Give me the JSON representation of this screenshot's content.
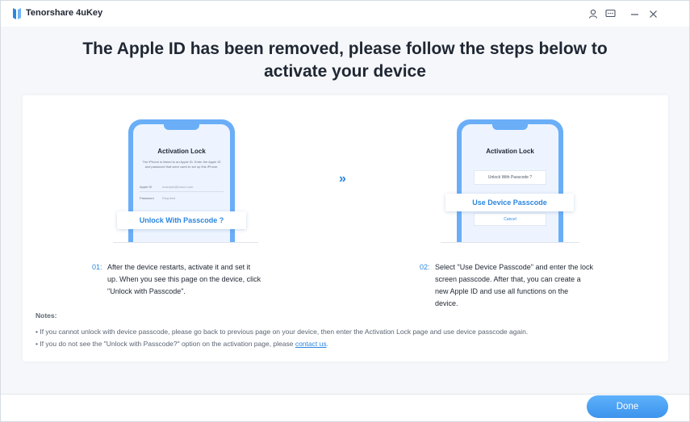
{
  "app": {
    "title": "Tenorshare 4uKey"
  },
  "titlebar": {
    "icons": [
      "user-icon",
      "feedback-icon",
      "minimize-icon",
      "close-icon"
    ]
  },
  "heading": {
    "line1": "The Apple ID has been removed, please follow the steps below to",
    "line2": "activate your device"
  },
  "phone1": {
    "title": "Activation Lock",
    "desc": "The iPhone is linked to an Apple ID. Enter the Apple ID and password that were used to set up this iPhone.",
    "apple_id_label": "Apple ID",
    "apple_id_value": "example@icloud.com",
    "password_label": "Password",
    "password_value": "Required",
    "button": "Unlock With Passcode ?"
  },
  "phone2": {
    "title": "Activation Lock",
    "option1": "Unlock With Passcode ?",
    "button": "Use Device Passcode",
    "cancel": "Cancel"
  },
  "steps": [
    {
      "num": "01:",
      "lines": [
        "After the device restarts, activate it and set it",
        "up. When you see this page on the device, click",
        "\"Unlock with Passcode\"."
      ]
    },
    {
      "num": "02:",
      "lines": [
        "Select \"Use Device Passcode\" and enter the lock",
        "screen passcode. After that, you can create a",
        "new Apple ID and use all functions on the",
        "device."
      ]
    }
  ],
  "notes": {
    "label": "Notes:",
    "item1": "• If you cannot unlock with device passcode, please go back to previous page on your device, then enter the Activation Lock page and use device passcode again.",
    "item2_prefix": "• If you do not see the \"Unlock with Passcode?\" option on the activation page, please ",
    "item2_link": "contact us",
    "item2_suffix": "."
  },
  "footer": {
    "done": "Done"
  },
  "colors": {
    "accent": "#2a86e0",
    "phone": "#6aaef7",
    "button": "#4aa3f5"
  }
}
